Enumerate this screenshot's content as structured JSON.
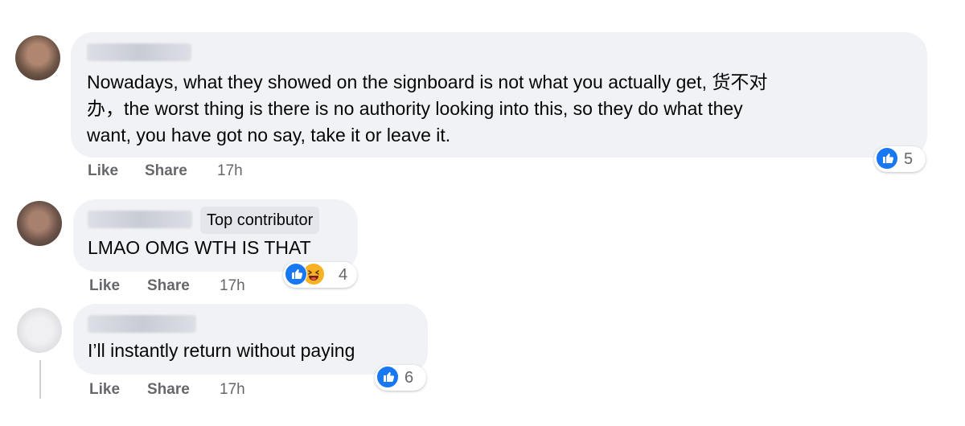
{
  "comments": [
    {
      "text": "Nowadays, what they showed on the signboard is not what you actually get, 货不对\n办，the worst thing is there is no authority looking into this, so they do what they\nwant, you have got no say, take it or leave it.",
      "actions": {
        "like": "Like",
        "share": "Share",
        "time": "17h"
      },
      "reactions": {
        "icons": [
          "like-icon"
        ],
        "count": "5"
      }
    },
    {
      "badge": "Top contributor",
      "text": "LMAO OMG WTH IS THAT",
      "actions": {
        "like": "Like",
        "share": "Share",
        "time": "17h"
      },
      "reactions": {
        "icons": [
          "like-icon",
          "haha-icon"
        ],
        "count": "4"
      }
    },
    {
      "text": "I’ll instantly return without paying",
      "actions": {
        "like": "Like",
        "share": "Share",
        "time": "17h"
      },
      "reactions": {
        "icons": [
          "like-icon"
        ],
        "count": "6"
      }
    }
  ],
  "colors": {
    "like_blue": "#1877f2",
    "haha_yellow": "#f7b125",
    "bubble_bg": "#f0f2f5",
    "meta_gray": "#65676b"
  }
}
